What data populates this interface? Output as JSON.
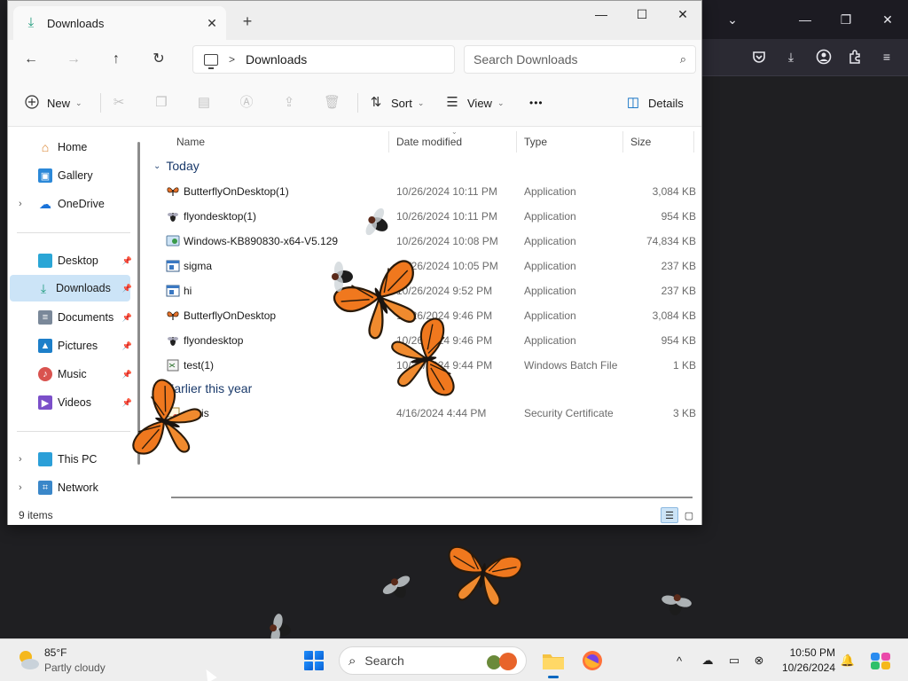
{
  "explorer": {
    "tab_title": "Downloads",
    "tab_close": "✕",
    "tab_add": "+",
    "window_controls": {
      "minimize": "—",
      "maximize": "☐",
      "close": "✕"
    },
    "nav": {
      "back": "←",
      "forward": "→",
      "up": "↑",
      "refresh": "↻"
    },
    "breadcrumb": {
      "separator": ">",
      "current": "Downloads"
    },
    "search": {
      "placeholder": "Search Downloads",
      "icon": "⌕"
    },
    "commands": {
      "new_label": "New",
      "sort_label": "Sort",
      "view_label": "View",
      "more_label": "•••",
      "details_label": "Details"
    },
    "sidebar": {
      "home": "Home",
      "gallery": "Gallery",
      "onedrive": "OneDrive",
      "desktop": "Desktop",
      "downloads": "Downloads",
      "documents": "Documents",
      "pictures": "Pictures",
      "music": "Music",
      "videos": "Videos",
      "this_pc": "This PC",
      "network": "Network"
    },
    "columns": {
      "name": "Name",
      "date": "Date modified",
      "type": "Type",
      "size": "Size"
    },
    "groups": {
      "today": "Today",
      "earlier": "Earlier this year"
    },
    "files_today": [
      {
        "name": "ButterflyOnDesktop(1)",
        "date": "10/26/2024 10:11 PM",
        "type": "Application",
        "size": "3,084 KB",
        "icon": "butterfly-icon"
      },
      {
        "name": "flyondesktop(1)",
        "date": "10/26/2024 10:11 PM",
        "type": "Application",
        "size": "954 KB",
        "icon": "fly-icon"
      },
      {
        "name": "Windows-KB890830-x64-V5.129",
        "date": "10/26/2024 10:08 PM",
        "type": "Application",
        "size": "74,834 KB",
        "icon": "installer-icon"
      },
      {
        "name": "sigma",
        "date": "10/26/2024 10:05 PM",
        "type": "Application",
        "size": "237 KB",
        "icon": "app-window-icon"
      },
      {
        "name": "hi",
        "date": "10/26/2024 9:52 PM",
        "type": "Application",
        "size": "237 KB",
        "icon": "app-window-icon"
      },
      {
        "name": "ButterflyOnDesktop",
        "date": "10/26/2024 9:46 PM",
        "type": "Application",
        "size": "3,084 KB",
        "icon": "butterfly-icon"
      },
      {
        "name": "flyondesktop",
        "date": "10/26/2024 9:46 PM",
        "type": "Application",
        "size": "954 KB",
        "icon": "fly-icon"
      },
      {
        "name": "test(1)",
        "date": "10/26/2024 9:44 PM",
        "type": "Windows Batch File",
        "size": "1 KB",
        "icon": "batch-file-icon"
      }
    ],
    "files_earlier": [
      {
        "name": "penis",
        "date": "4/16/2024 4:44 PM",
        "type": "Security Certificate",
        "size": "3 KB",
        "icon": "certificate-icon"
      }
    ],
    "status": {
      "item_count": "9 items"
    }
  },
  "taskbar": {
    "weather": {
      "temp": "85°F",
      "desc": "Partly cloudy"
    },
    "search_label": "Search",
    "clock": {
      "time": "10:50 PM",
      "date": "10/26/2024"
    }
  },
  "colors": {
    "accent": "#0067c0",
    "selection": "#cce4f7",
    "butterfly_orange": "#f0781e",
    "desktop_bg": "#1f1f22"
  }
}
